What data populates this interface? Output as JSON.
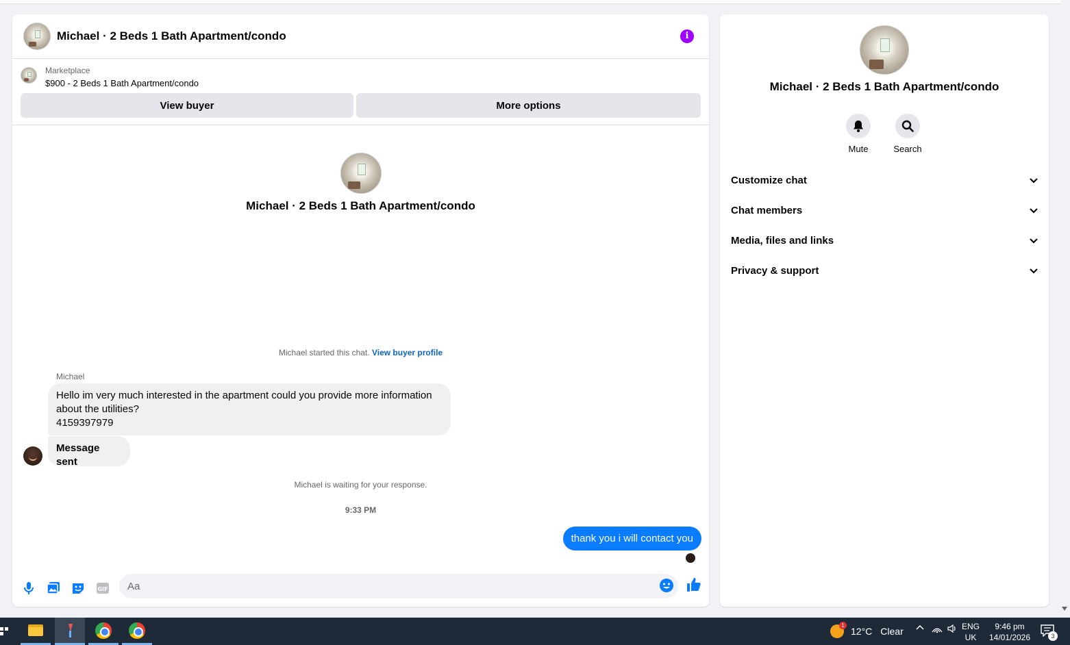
{
  "chat": {
    "title": "Michael · 2 Beds 1 Bath Apartment/condo",
    "listing": {
      "category": "Marketplace",
      "price_title": "$900 - 2 Beds 1 Bath Apartment/condo"
    },
    "buttons": {
      "view_buyer": "View buyer",
      "more_options": "More options"
    },
    "intro_name": "Michael · 2 Beds 1 Bath Apartment/condo",
    "started_text": "Michael started this chat.",
    "started_link": "View buyer profile",
    "sender_name": "Michael",
    "messages_in": [
      {
        "lines": [
          "Hello im very much interested in the apartment could you provide more information",
          "about the utilities?",
          "4159397979"
        ]
      },
      {
        "text": "Message sent"
      }
    ],
    "waiting_text": "Michael is waiting for your response.",
    "timestamp": "9:33 PM",
    "message_out": "thank you i will contact you",
    "composer": {
      "placeholder": "Aa"
    }
  },
  "panel": {
    "name": "Michael · 2 Beds 1 Bath Apartment/condo",
    "actions": {
      "mute": "Mute",
      "search": "Search"
    },
    "sections": [
      "Customize chat",
      "Chat members",
      "Media, files and links",
      "Privacy & support"
    ]
  },
  "taskbar": {
    "weather_temp": "12°C",
    "weather_desc": "Clear",
    "weather_badge": "1",
    "lang_top": "ENG",
    "lang_bottom": "UK",
    "time": "9:46 pm",
    "date": "14/01/2026",
    "notification_count": "3"
  },
  "colors": {
    "accent_blue": "#0a7cff",
    "info_purple": "#a100ff",
    "link_blue": "#0a66c2"
  }
}
